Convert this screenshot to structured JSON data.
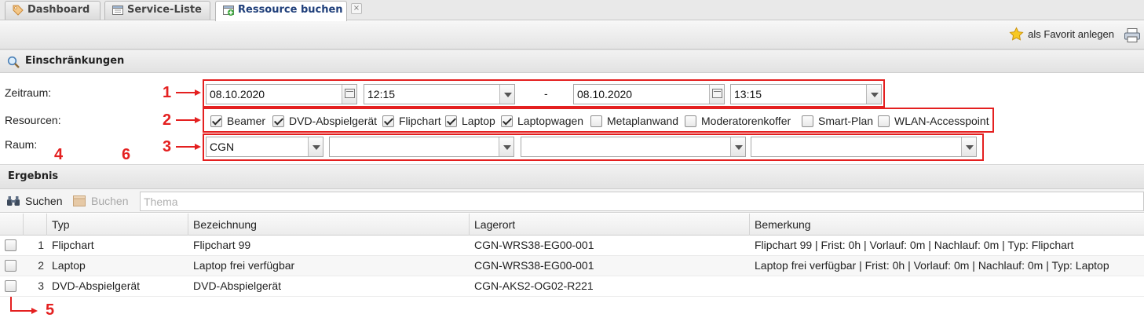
{
  "tabs": [
    {
      "label": "Dashboard"
    },
    {
      "label": "Service-Liste"
    },
    {
      "label": "Ressource buchen",
      "active": true
    }
  ],
  "tab_close": "×",
  "toolbar": {
    "favorite_label": "als Favorit anlegen"
  },
  "restrictions": {
    "title": "Einschränkungen",
    "zeitraum_label": "Zeitraum:",
    "resourcen_label": "Resourcen:",
    "raum_label": "Raum:",
    "date_from": "08.10.2020",
    "time_from": "12:15",
    "separator": "-",
    "date_to": "08.10.2020",
    "time_to": "13:15",
    "resources": [
      {
        "label": "Beamer",
        "checked": true
      },
      {
        "label": "DVD-Abspielgerät",
        "checked": true
      },
      {
        "label": "Flipchart",
        "checked": true
      },
      {
        "label": "Laptop",
        "checked": true
      },
      {
        "label": "Laptopwagen",
        "checked": true
      },
      {
        "label": "Metaplanwand",
        "checked": false
      },
      {
        "label": "Moderatorenkoffer",
        "checked": false
      },
      {
        "label": "Smart-Plan",
        "checked": false
      },
      {
        "label": "WLAN-Accesspoint",
        "checked": false
      }
    ],
    "raum": [
      "CGN",
      "",
      "",
      ""
    ]
  },
  "annotations": {
    "n1": "1",
    "n2": "2",
    "n3": "3",
    "n4": "4",
    "n5": "5",
    "n6": "6"
  },
  "result": {
    "title": "Ergebnis",
    "search_label": "Suchen",
    "book_label": "Buchen",
    "topic_placeholder": "Thema",
    "columns": [
      "Typ",
      "Bezeichnung",
      "Lagerort",
      "Bemerkung"
    ],
    "rows": [
      {
        "num": "1",
        "typ": "Flipchart",
        "bezeichnung": "Flipchart 99",
        "lagerort": "CGN-WRS38-EG00-001",
        "bemerkung": "Flipchart 99 | Frist: 0h | Vorlauf: 0m | Nachlauf: 0m | Typ: Flipchart"
      },
      {
        "num": "2",
        "typ": "Laptop",
        "bezeichnung": "Laptop frei verfügbar",
        "lagerort": "CGN-WRS38-EG00-001",
        "bemerkung": "Laptop frei verfügbar | Frist: 0h | Vorlauf: 0m | Nachlauf: 0m | Typ: Laptop"
      },
      {
        "num": "3",
        "typ": "DVD-Abspielgerät",
        "bezeichnung": "DVD-Abspielgerät",
        "lagerort": "CGN-AKS2-OG02-R221",
        "bemerkung": ""
      }
    ]
  }
}
